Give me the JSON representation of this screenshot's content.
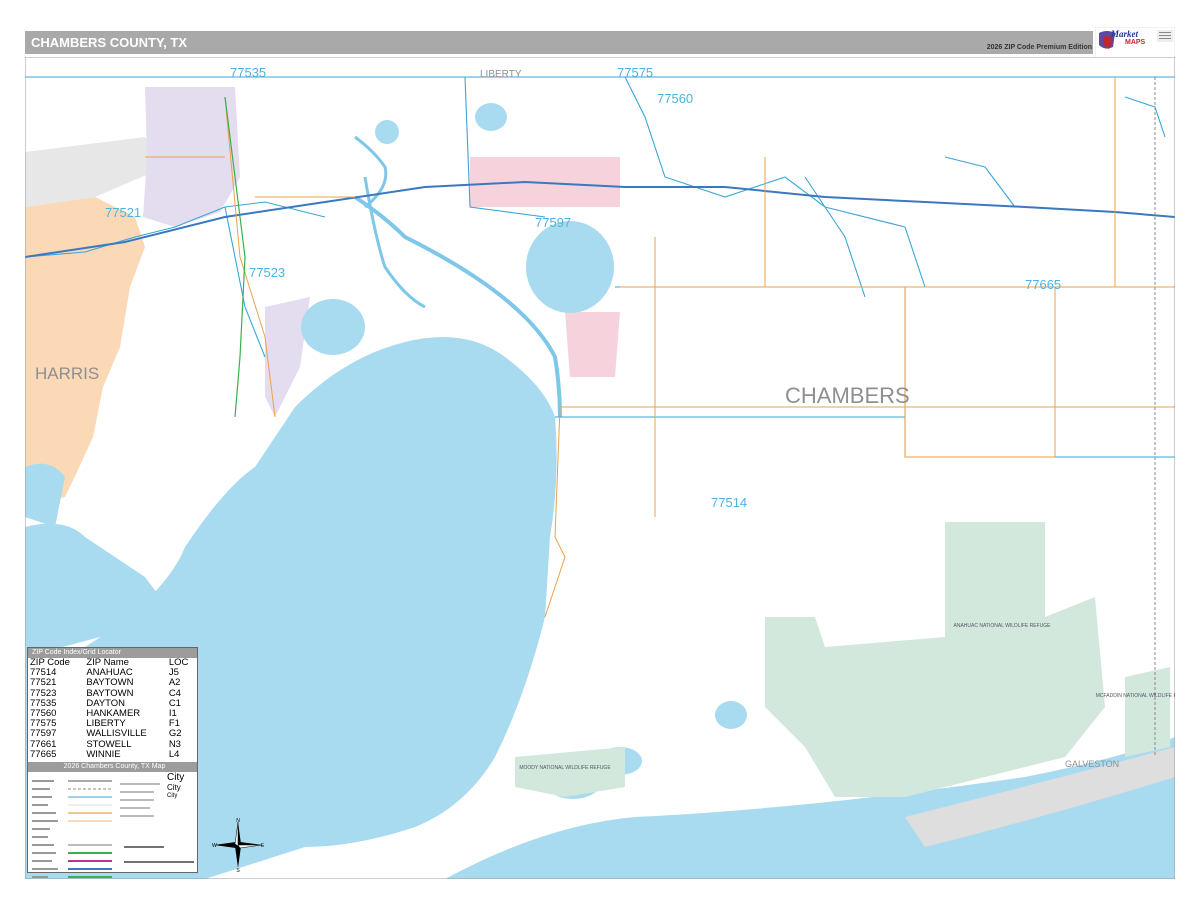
{
  "header": {
    "title": "CHAMBERS COUNTY, TX",
    "edition": "2026 ZIP Code Premium Edition",
    "logo_line1": "Market",
    "logo_line2": "MAPS"
  },
  "map": {
    "county_label": "CHAMBERS",
    "neighbor_counties": [
      "HARRIS",
      "LIBERTY",
      "GALVESTON"
    ],
    "zip_labels": [
      "77535",
      "77575",
      "77560",
      "77521",
      "77597",
      "77523",
      "77665",
      "77514"
    ],
    "colors": {
      "water": "#a9dbf0",
      "refuge": "#d3e8dd",
      "zip_boundary": "#3aa6d6",
      "interstate": "#3a78c0",
      "roads": "#e8a34a",
      "harris_orange": "#fbd9b6",
      "baytown_purple": "#e4dcef",
      "wallisville_pink": "#f6d3dc",
      "state_boundary": "#8a8a8a"
    },
    "area_labels": [
      "ANAHUAC NATIONAL WILDLIFE REFUGE",
      "MOODY NATIONAL WILDLIFE REFUGE",
      "MCFADDIN NATIONAL WILDLIFE REFUGE"
    ]
  },
  "zip_index": {
    "title": "ZIP Code Index/Grid Locator",
    "columns": [
      "ZIP Code",
      "ZIP Name",
      "LOC"
    ],
    "rows": [
      [
        "77514",
        "ANAHUAC",
        "J5"
      ],
      [
        "77521",
        "BAYTOWN",
        "A2"
      ],
      [
        "77523",
        "BAYTOWN",
        "C4"
      ],
      [
        "77535",
        "DAYTON",
        "C1"
      ],
      [
        "77560",
        "HANKAMER",
        "I1"
      ],
      [
        "77575",
        "LIBERTY",
        "F1"
      ],
      [
        "77597",
        "WALLISVILLE",
        "G2"
      ],
      [
        "77661",
        "STOWELL",
        "N3"
      ],
      [
        "77665",
        "WINNIE",
        "L4"
      ]
    ]
  },
  "map_legend": {
    "title": "2026 Chambers County, TX Map",
    "city_sample_large": "City",
    "city_sample_medium": "City",
    "city_sample_small": "City"
  },
  "compass": {
    "n": "N",
    "s": "S",
    "e": "E",
    "w": "W"
  }
}
